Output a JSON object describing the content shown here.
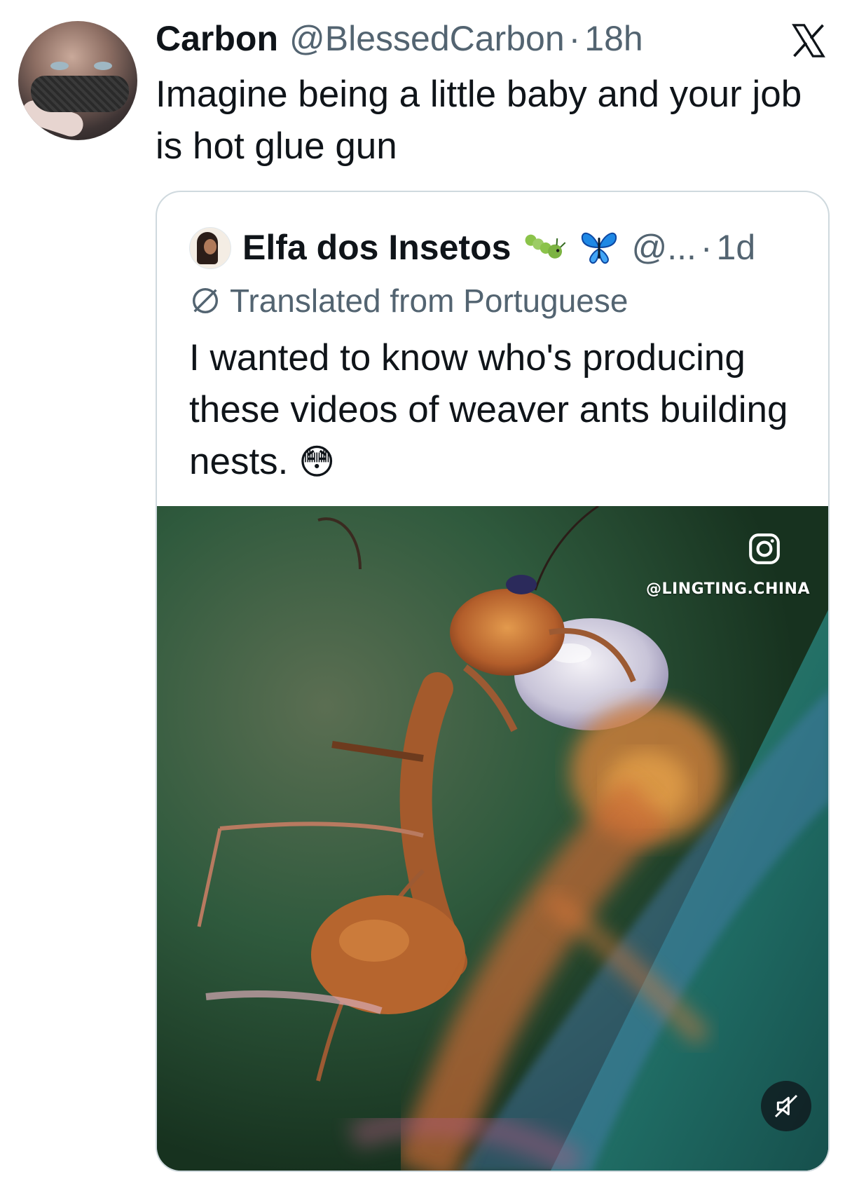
{
  "tweet": {
    "author_name": "Carbon",
    "author_handle": "@BlessedCarbon",
    "separator": "·",
    "time": "18h",
    "text": "Imagine being a little baby and your job is hot glue gun"
  },
  "quoted_tweet": {
    "author_name": "Elfa dos Insetos",
    "author_handle": "@...",
    "separator": "·",
    "time": "1d",
    "translation_label": "Translated from Portuguese",
    "text": "I wanted to know who's producing these videos of weaver ants building nests.",
    "text_emoji": "😳",
    "name_emojis": [
      "caterpillar-icon",
      "butterfly-icon"
    ],
    "media": {
      "watermark": "@LINGTING.CHINA",
      "watermark_icon": "instagram-icon",
      "mute_icon": "muted-speaker-icon"
    }
  },
  "colors": {
    "text_primary": "#0f1419",
    "text_secondary": "#536471",
    "border": "#cfd9de"
  }
}
